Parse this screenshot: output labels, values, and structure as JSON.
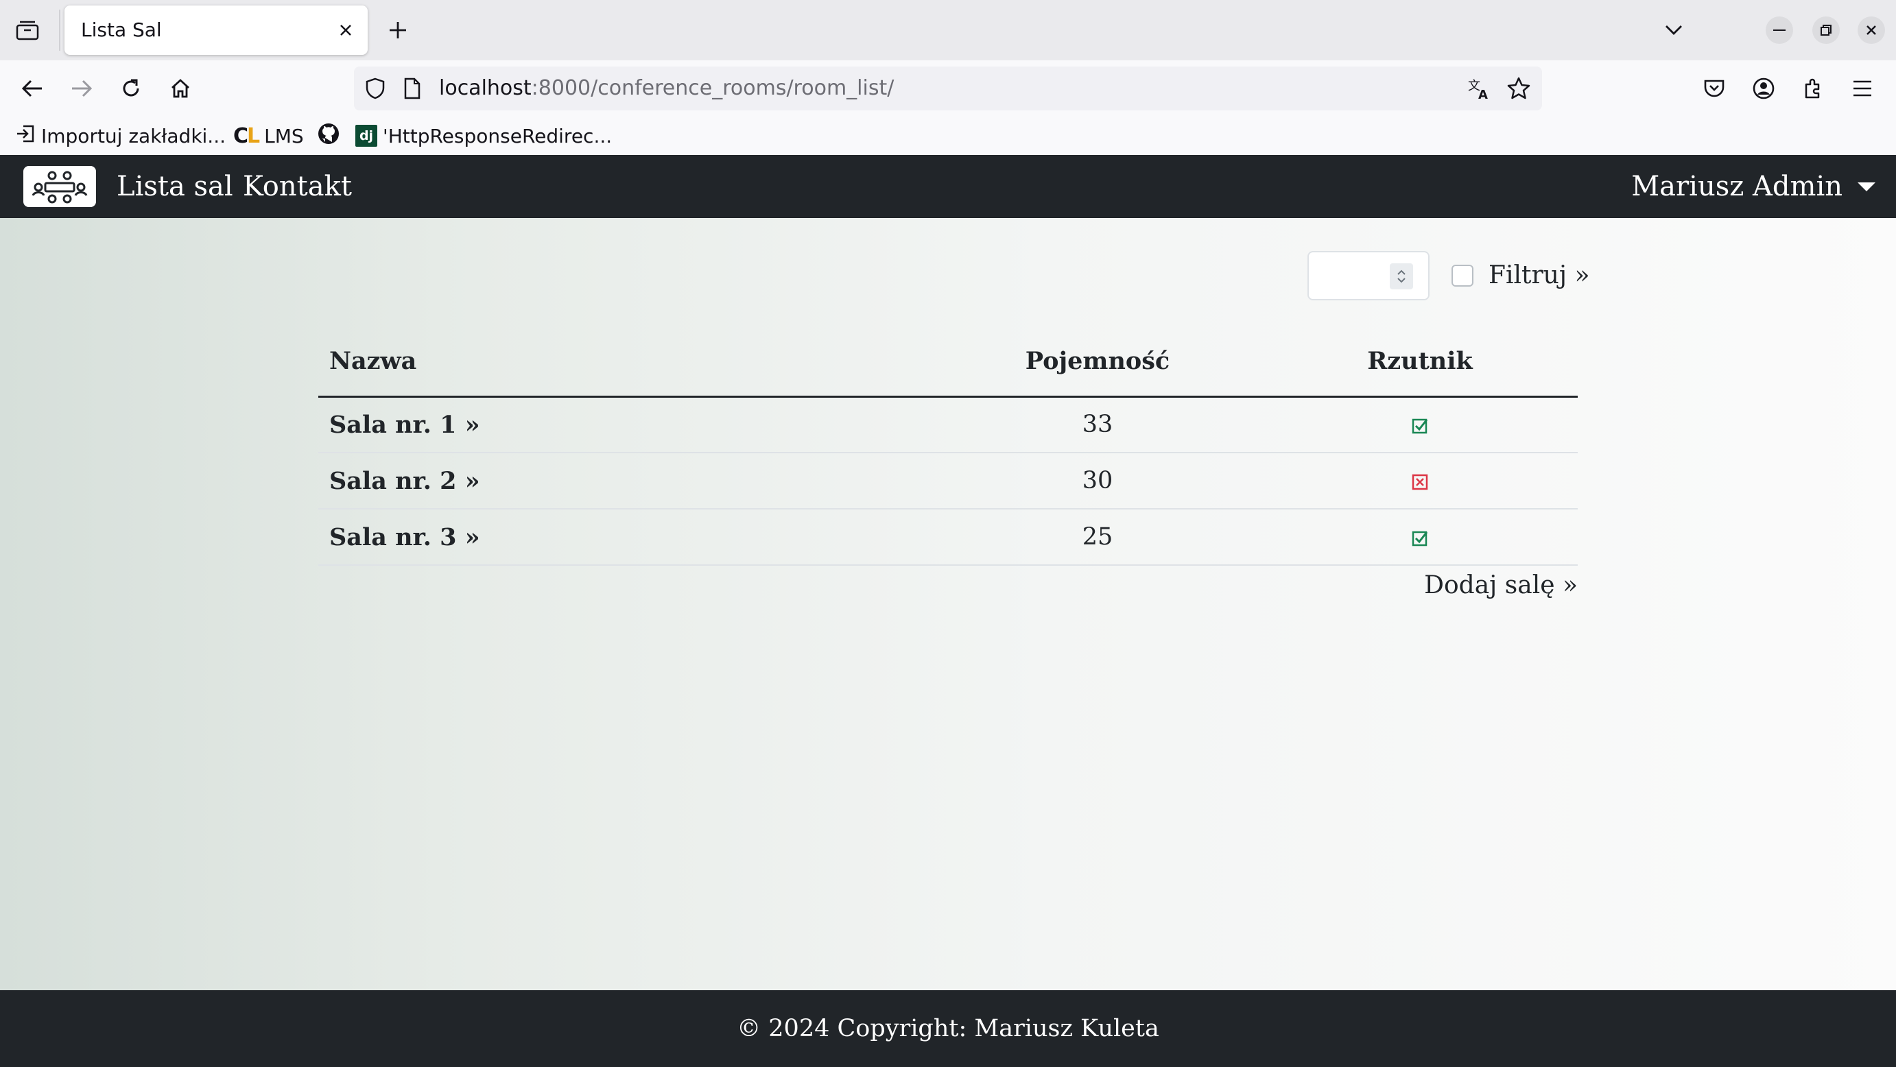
{
  "browser": {
    "tab_title": "Lista Sal",
    "url_host": "localhost",
    "url_rest": ":8000/conference_rooms/room_list/",
    "bookmarks": [
      {
        "label": "Importuj zakładki..."
      },
      {
        "label": "LMS"
      },
      {
        "label": ""
      },
      {
        "label": "'HttpResponseRedirec..."
      }
    ]
  },
  "site_nav": {
    "links": [
      "Lista sal",
      "Kontakt"
    ],
    "user": "Mariusz Admin"
  },
  "filter": {
    "capacity_value": "",
    "checkbox_checked": false,
    "label": "Filtruj »"
  },
  "table": {
    "headers": [
      "Nazwa",
      "Pojemność",
      "Rzutnik"
    ],
    "rows": [
      {
        "name": "Sala nr. 1 »",
        "capacity": "33",
        "projector": true
      },
      {
        "name": "Sala nr. 2 »",
        "capacity": "30",
        "projector": false
      },
      {
        "name": "Sala nr. 3 »",
        "capacity": "25",
        "projector": true
      }
    ]
  },
  "add_room_label": "Dodaj salę »",
  "footer": {
    "text": "© 2024 Copyright: Mariusz Kuleta"
  },
  "colors": {
    "nav_bg": "#212529",
    "yes": "#198754",
    "no": "#dc3545"
  }
}
